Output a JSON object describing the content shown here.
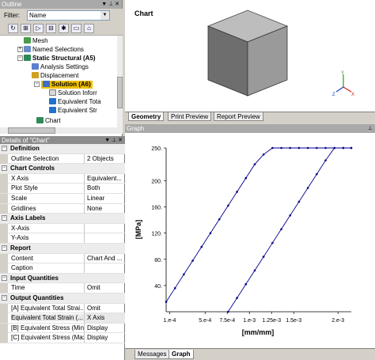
{
  "outline": {
    "title": "Outline",
    "filter_label": "Filter:",
    "filter_value": "Name",
    "tree": [
      {
        "label": "Mesh",
        "bold": false
      },
      {
        "label": "Named Selections",
        "bold": false
      },
      {
        "label": "Static Structural (A5)",
        "bold": true
      },
      {
        "label": "Analysis Settings",
        "bold": false
      },
      {
        "label": "Displacement",
        "bold": false
      },
      {
        "label": "Solution (A6)",
        "bold": true
      },
      {
        "label": "Solution Inforr",
        "bold": false
      },
      {
        "label": "Equivalent Tota",
        "bold": false
      },
      {
        "label": "Equivalent Str",
        "bold": false
      },
      {
        "label": "Chart",
        "bold": false
      }
    ]
  },
  "details": {
    "title": "Details of \"Chart\"",
    "rows": [
      {
        "group": true,
        "key": "Definition",
        "value": ""
      },
      {
        "group": false,
        "key": "Outline Selection",
        "value": "2 Objects"
      },
      {
        "group": true,
        "key": "Chart Controls",
        "value": ""
      },
      {
        "group": false,
        "key": "X Axis",
        "value": "Equivalent..."
      },
      {
        "group": false,
        "key": "Plot Style",
        "value": "Both"
      },
      {
        "group": false,
        "key": "Scale",
        "value": "Linear"
      },
      {
        "group": false,
        "key": "Gridlines",
        "value": "None"
      },
      {
        "group": true,
        "key": "Axis Labels",
        "value": ""
      },
      {
        "group": false,
        "key": "X-Axis",
        "value": ""
      },
      {
        "group": false,
        "key": "Y-Axis",
        "value": ""
      },
      {
        "group": true,
        "key": "Report",
        "value": ""
      },
      {
        "group": false,
        "key": "Content",
        "value": "Chart And ..."
      },
      {
        "group": false,
        "key": "Caption",
        "value": ""
      },
      {
        "group": true,
        "key": "Input Quantities",
        "value": ""
      },
      {
        "group": false,
        "key": "Time",
        "value": "Omit"
      },
      {
        "group": true,
        "key": "Output Quantities",
        "value": ""
      },
      {
        "group": false,
        "key": "[A] Equivalent Total Strai...",
        "value": "Omit"
      },
      {
        "group": false,
        "key": "Equivalent Total Strain (...",
        "value": "X Axis"
      },
      {
        "group": false,
        "key": "[B] Equivalent Stress (Min)",
        "value": "Display"
      },
      {
        "group": false,
        "key": "[C] Equivalent Stress (Max)",
        "value": "Display"
      }
    ]
  },
  "chartview": {
    "title": "Chart"
  },
  "view_tabs": [
    "Geometry",
    "Print Preview",
    "Report Preview"
  ],
  "graph_title": "Graph",
  "bottom_tabs": [
    "Messages",
    "Graph"
  ],
  "chart_data": {
    "type": "line",
    "xlabel": "[mm/mm]",
    "ylabel": "[MPa]",
    "xlim": [
      6e-05,
      0.00215
    ],
    "ylim": [
      0,
      250
    ],
    "x_ticks": [
      "1.e-4",
      "5.e-4",
      "7.5e-4",
      "1.e-3",
      "1.25e-3",
      "1.5e-3",
      "2.e-3"
    ],
    "x_tick_values": [
      0.0001,
      0.0005,
      0.00075,
      0.001,
      0.00125,
      0.0015,
      0.002
    ],
    "y_ticks": [
      "40.",
      "80.",
      "120.",
      "160.",
      "200.",
      "250."
    ],
    "y_tick_values": [
      40,
      80,
      120,
      160,
      200,
      250
    ],
    "grid": false,
    "line_color": "#00008b",
    "series": [
      {
        "x": [
          6e-05,
          0.00016,
          0.00026,
          0.00036,
          0.00046,
          0.00056,
          0.00066,
          0.00076,
          0.00086,
          0.00096,
          0.00106,
          0.00116,
          0.00126,
          0.00136,
          0.00146,
          0.00156,
          0.00166,
          0.00176,
          0.00186,
          0.00196,
          0.00206,
          0.00215
        ],
        "y": [
          15,
          36,
          57,
          78,
          99,
          120,
          141,
          162,
          183,
          204,
          225,
          240,
          250,
          250,
          250,
          250,
          250,
          250,
          250,
          250,
          250,
          250
        ]
      },
      {
        "x": [
          0.00076,
          0.00086,
          0.00096,
          0.00106,
          0.00116,
          0.00126,
          0.00136,
          0.00146,
          0.00156,
          0.00166,
          0.00176,
          0.00186,
          0.00196,
          0.00206,
          0.00215
        ],
        "y": [
          0,
          21,
          42,
          63,
          84,
          105,
          126,
          147,
          168,
          189,
          210,
          231,
          250,
          250,
          250
        ]
      }
    ]
  }
}
